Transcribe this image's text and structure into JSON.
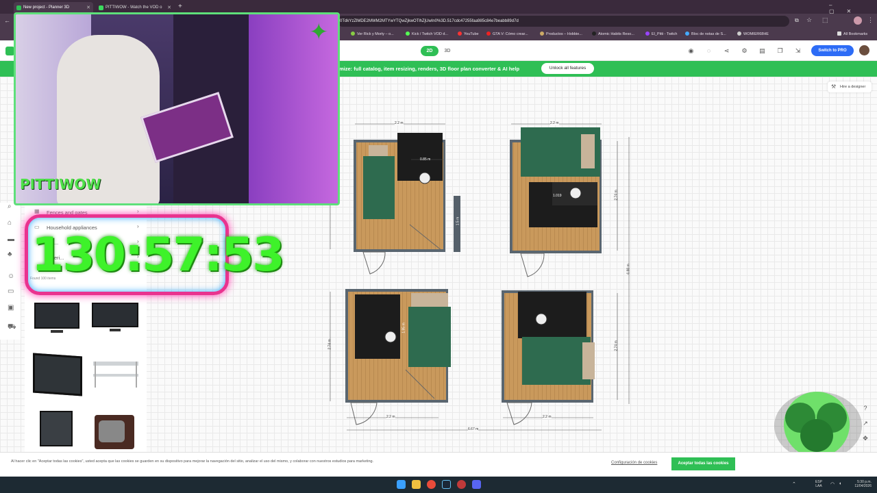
{
  "browser": {
    "tabs": [
      {
        "title": "New project - Planner 3D",
        "active": true
      },
      {
        "title": "PITTIWOW - Watch the VOD o",
        "active": false
      }
    ],
    "url": "0TdkYzZlMDE2MWM2MTYwYTQwZjkwOTlhZjUwIn0%3D.517cdc47255faa985c84e7beabb89d7d",
    "bookmarks": [
      "Ver Rick y Morty – o...",
      "Kick / Twitch VOD d...",
      "YouTube",
      "GTA V: Cómo crear...",
      "Productos – Hobbie...",
      "Atomic Habits Reso...",
      "El_Pitti - Twitch",
      "Bloc de notas de S...",
      "WOMIER68HE"
    ],
    "all_bookmarks": "All Bookmarks"
  },
  "app": {
    "mode_2d": "2D",
    "mode_3d": "3D",
    "switch_pro": "Switch to PRO",
    "banner_text": "mize: full catalog, item resizing, renders, 3D floor plan converter & AI help",
    "unlock": "Unlock all features",
    "hire": "Hire a designer"
  },
  "catalog": {
    "rows": [
      "Fences and gates",
      "Household appliances",
      "Wa...",
      "Exteri..."
    ],
    "found": "Found 100 items"
  },
  "overlay": {
    "timer": "130:57:53",
    "streamer_logo": "PITTIWOW"
  },
  "plan": {
    "dims": {
      "top_width_a": "2.2 m",
      "top_width_b": "2.2 m",
      "inner_a": "0.85 m",
      "side_a": "1.5 m",
      "inner_b": "1.019",
      "height_b": "2.74 m",
      "total_height": "6.88 m",
      "height_c": "2.74 m",
      "inner_c": "1.95 m",
      "height_d": "2.74 m",
      "bottom_c": "2.2 m",
      "bottom_d": "2.2 m",
      "total_width": "6.67 m"
    }
  },
  "cookie": {
    "text": "Al hacer clic en \"Aceptar todas las cookies\", usted acepta que las cookies se guarden en su dispositivo para mejorar la navegación del sitio, analizar el uso del mismo, y colaborar con nuestros estudios para marketing.",
    "config": "Configuración de cookies",
    "accept": "Aceptar todas las cookies"
  },
  "taskbar": {
    "lang1": "ESP",
    "lang2": "LAA",
    "time": "5:30 p.m.",
    "date": "11/04/2026"
  },
  "colors": {
    "green": "#2fbf55",
    "blue": "#2d6cf6",
    "floor": "#c79a5e",
    "bed": "#2e6b4f",
    "timer_green": "#3ef22a",
    "timer_pink": "#e9338f"
  }
}
